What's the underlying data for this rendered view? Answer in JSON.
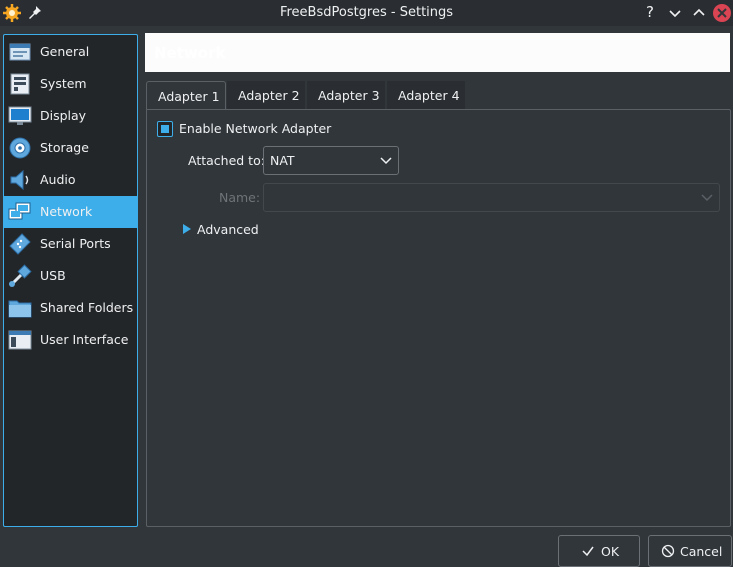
{
  "window": {
    "title": "FreeBsdPostgres - Settings",
    "help_glyph": "?",
    "accent": "#3daee9",
    "close_color": "#da4453"
  },
  "sidebar": {
    "items": [
      {
        "label": "General",
        "icon": "general-icon"
      },
      {
        "label": "System",
        "icon": "system-icon"
      },
      {
        "label": "Display",
        "icon": "display-icon"
      },
      {
        "label": "Storage",
        "icon": "storage-icon"
      },
      {
        "label": "Audio",
        "icon": "audio-icon"
      },
      {
        "label": "Network",
        "icon": "network-icon",
        "selected": true
      },
      {
        "label": "Serial Ports",
        "icon": "serial-ports-icon"
      },
      {
        "label": "USB",
        "icon": "usb-icon"
      },
      {
        "label": "Shared Folders",
        "icon": "shared-folders-icon"
      },
      {
        "label": "User Interface",
        "icon": "user-interface-icon"
      }
    ]
  },
  "page": {
    "title": "Network"
  },
  "tabs": [
    {
      "label": "Adapter 1",
      "active": true
    },
    {
      "label": "Adapter 2"
    },
    {
      "label": "Adapter 3"
    },
    {
      "label": "Adapter 4"
    }
  ],
  "adapter": {
    "enable_label": "Enable Network Adapter",
    "enabled": true,
    "attached_label": "Attached to:",
    "attached_value": "NAT",
    "name_label": "Name:",
    "name_value": "",
    "advanced_label": "Advanced"
  },
  "buttons": {
    "ok": "OK",
    "cancel": "Cancel"
  }
}
